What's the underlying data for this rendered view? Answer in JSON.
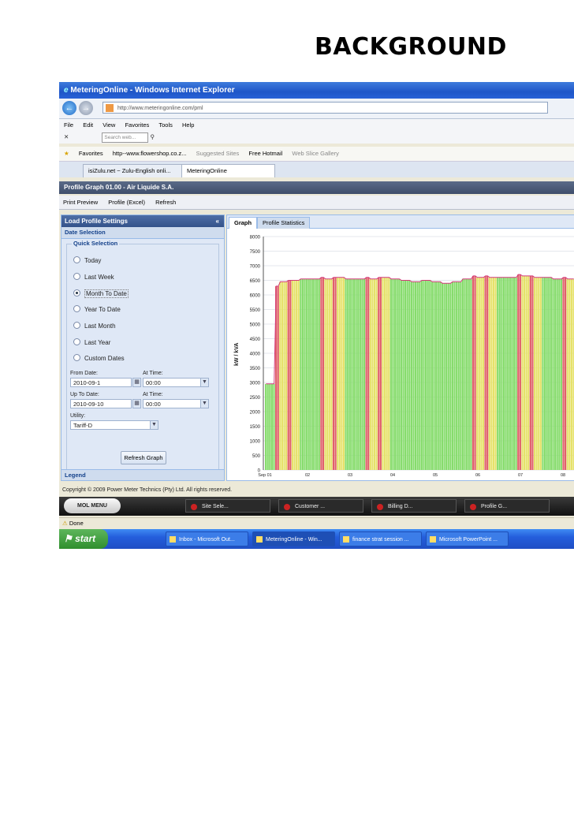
{
  "slide": {
    "title": "BACKGROUND"
  },
  "browser": {
    "window_title": "MeteringOnline - Windows Internet Explorer",
    "url": "http://www.meteringonline.com/pml",
    "menu": [
      "File",
      "Edit",
      "View",
      "Favorites",
      "Tools",
      "Help"
    ],
    "search_placeholder": "Search web...",
    "favorites_label": "Favorites",
    "favorites": [
      "http--www.flowershop.co.z...",
      "Suggested Sites",
      "Free Hotmail",
      "Web Slice Gallery"
    ],
    "tabs": [
      "isiZulu.net ~ Zulu-English onli...",
      "MeteringOnline"
    ],
    "status": "Done"
  },
  "app": {
    "header": "Profile Graph 01.00 - Air Liquide S.A.",
    "toolbar": [
      "Print Preview",
      "Profile (Excel)",
      "Refresh"
    ],
    "left_panel": {
      "title": "Load Profile Settings",
      "date_selection": "Date Selection",
      "quick_selection": "Quick Selection",
      "options": [
        "Today",
        "Last Week",
        "Month To Date",
        "Year To Date",
        "Last Month",
        "Last Year",
        "Custom Dates"
      ],
      "selected": "Month To Date",
      "from_date_label": "From Date:",
      "from_date": "2010-09-1",
      "from_time_label": "At Time:",
      "from_time": "00:00",
      "to_date_label": "Up To Date:",
      "to_date": "2010-09-10",
      "to_time_label": "At Time:",
      "to_time": "00:00",
      "utility_label": "Utility:",
      "utility": "Tariff-D",
      "refresh_button": "Refresh Graph",
      "legend": "Legend"
    },
    "right_tabs": [
      "Graph",
      "Profile Statistics"
    ],
    "copyright": "Copyright © 2009 Power Meter Technics (Pty) Ltd. All rights reserved."
  },
  "chart_data": {
    "type": "bar",
    "ylabel": "kW / kVA",
    "ylim": [
      0,
      8000
    ],
    "yticks": [
      0,
      500,
      1000,
      1500,
      2000,
      2500,
      3000,
      3500,
      4000,
      4500,
      5000,
      5500,
      6000,
      6500,
      7000,
      7500,
      8000
    ],
    "xticks": [
      "Sep 01",
      "02",
      "03",
      "04",
      "05",
      "06",
      "07",
      "08"
    ],
    "grid": true,
    "colors": {
      "peak": "#e0606a",
      "standard": "#e6e26a",
      "offpeak": "#86dc6c",
      "line": "#d23a7a"
    },
    "series": [
      {
        "day": "Sep 01",
        "segments": [
          {
            "period": "offpeak",
            "value": 2950
          },
          {
            "period": "peak",
            "value": 6300
          },
          {
            "period": "standard",
            "value": 6450
          },
          {
            "period": "peak",
            "value": 6500
          },
          {
            "period": "standard",
            "value": 6500
          },
          {
            "period": "offpeak",
            "value": 6550
          }
        ]
      },
      {
        "day": "02",
        "segments": [
          {
            "period": "offpeak",
            "value": 6550
          },
          {
            "period": "peak",
            "value": 6600
          },
          {
            "period": "standard",
            "value": 6550
          },
          {
            "period": "peak",
            "value": 6600
          },
          {
            "period": "standard",
            "value": 6600
          },
          {
            "period": "offpeak",
            "value": 6550
          }
        ]
      },
      {
        "day": "03",
        "segments": [
          {
            "period": "offpeak",
            "value": 6550
          },
          {
            "period": "peak",
            "value": 6600
          },
          {
            "period": "standard",
            "value": 6550
          },
          {
            "period": "peak",
            "value": 6600
          },
          {
            "period": "standard",
            "value": 6600
          },
          {
            "period": "offpeak",
            "value": 6550
          }
        ]
      },
      {
        "day": "04",
        "segments": [
          {
            "period": "offpeak",
            "value": 6500
          },
          {
            "period": "offpeak",
            "value": 6450
          },
          {
            "period": "offpeak",
            "value": 6500
          }
        ]
      },
      {
        "day": "05",
        "segments": [
          {
            "period": "offpeak",
            "value": 6450
          },
          {
            "period": "offpeak",
            "value": 6400
          },
          {
            "period": "offpeak",
            "value": 6450
          }
        ]
      },
      {
        "day": "06",
        "segments": [
          {
            "period": "offpeak",
            "value": 6550
          },
          {
            "period": "peak",
            "value": 6650
          },
          {
            "period": "standard",
            "value": 6600
          },
          {
            "period": "peak",
            "value": 6650
          },
          {
            "period": "standard",
            "value": 6600
          },
          {
            "period": "offpeak",
            "value": 6600
          }
        ]
      },
      {
        "day": "07",
        "segments": [
          {
            "period": "offpeak",
            "value": 6600
          },
          {
            "period": "peak",
            "value": 6700
          },
          {
            "period": "standard",
            "value": 6650
          },
          {
            "period": "peak",
            "value": 6650
          },
          {
            "period": "standard",
            "value": 6600
          },
          {
            "period": "offpeak",
            "value": 6600
          }
        ]
      },
      {
        "day": "08",
        "segments": [
          {
            "period": "offpeak",
            "value": 6550
          },
          {
            "period": "peak",
            "value": 6600
          },
          {
            "period": "standard",
            "value": 6550
          }
        ]
      }
    ]
  },
  "taskbars": {
    "mol_menu": "MOL MENU",
    "app_tasks": [
      "Site Sele...",
      "Customer ...",
      "Billing D...",
      "Profile G..."
    ],
    "start": "start",
    "windows_tasks": [
      "Inbox - Microsoft Out...",
      "MeteringOnline - Win...",
      "finance strat session ...",
      "Microsoft PowerPoint ..."
    ]
  }
}
